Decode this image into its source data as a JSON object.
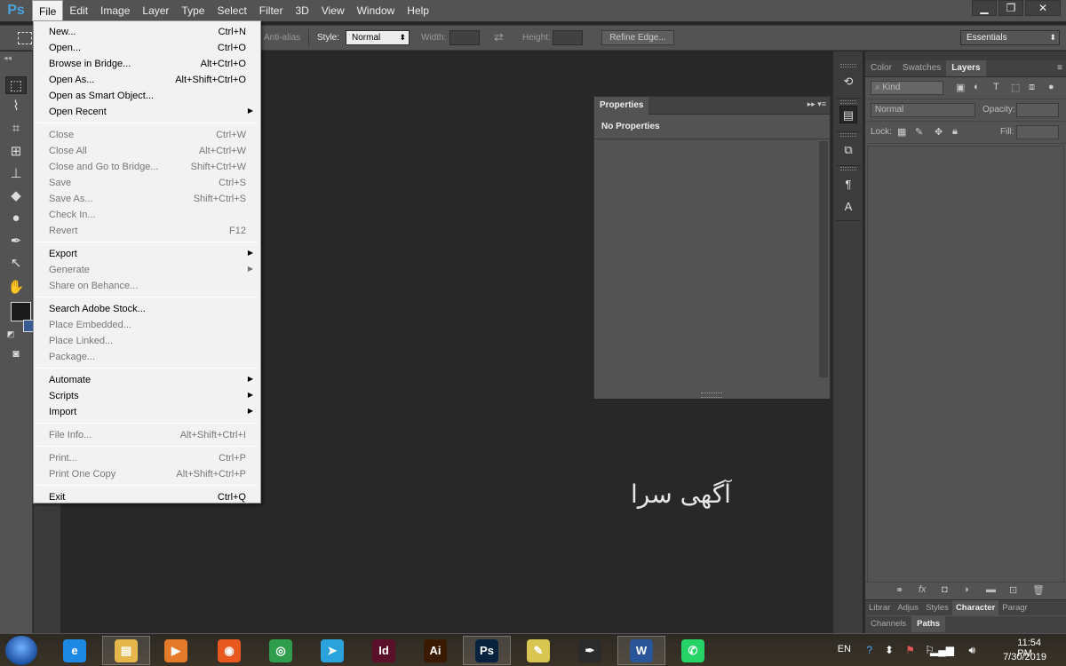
{
  "app": {
    "logo": "Ps"
  },
  "menubar": {
    "items": [
      "File",
      "Edit",
      "Image",
      "Layer",
      "Type",
      "Select",
      "Filter",
      "3D",
      "View",
      "Window",
      "Help"
    ]
  },
  "window_controls": {
    "minimize": "▁",
    "restore": "❐",
    "close": "✕"
  },
  "options_bar": {
    "anti_alias": "Anti-alias",
    "style_label": "Style:",
    "style_value": "Normal",
    "width_label": "Width:",
    "height_label": "Height:",
    "refine_edge": "Refine Edge...",
    "workspace": "Essentials"
  },
  "file_menu": {
    "items": [
      {
        "label": "New...",
        "shortcut": "Ctrl+N",
        "enabled": true
      },
      {
        "label": "Open...",
        "shortcut": "Ctrl+O",
        "enabled": true
      },
      {
        "label": "Browse in Bridge...",
        "shortcut": "Alt+Ctrl+O",
        "enabled": true
      },
      {
        "label": "Open As...",
        "shortcut": "Alt+Shift+Ctrl+O",
        "enabled": true
      },
      {
        "label": "Open as Smart Object...",
        "shortcut": "",
        "enabled": true
      },
      {
        "label": "Open Recent",
        "shortcut": "",
        "enabled": true,
        "submenu": true
      },
      {
        "label": "Close",
        "shortcut": "Ctrl+W",
        "enabled": false
      },
      {
        "label": "Close All",
        "shortcut": "Alt+Ctrl+W",
        "enabled": false
      },
      {
        "label": "Close and Go to Bridge...",
        "shortcut": "Shift+Ctrl+W",
        "enabled": false
      },
      {
        "label": "Save",
        "shortcut": "Ctrl+S",
        "enabled": false
      },
      {
        "label": "Save As...",
        "shortcut": "Shift+Ctrl+S",
        "enabled": false
      },
      {
        "label": "Check In...",
        "shortcut": "",
        "enabled": false
      },
      {
        "label": "Revert",
        "shortcut": "F12",
        "enabled": false
      },
      {
        "label": "Export",
        "shortcut": "",
        "enabled": true,
        "submenu": true
      },
      {
        "label": "Generate",
        "shortcut": "",
        "enabled": false,
        "submenu": true
      },
      {
        "label": "Share on Behance...",
        "shortcut": "",
        "enabled": false
      },
      {
        "label": "Search Adobe Stock...",
        "shortcut": "",
        "enabled": true
      },
      {
        "label": "Place Embedded...",
        "shortcut": "",
        "enabled": false
      },
      {
        "label": "Place Linked...",
        "shortcut": "",
        "enabled": false
      },
      {
        "label": "Package...",
        "shortcut": "",
        "enabled": false
      },
      {
        "label": "Automate",
        "shortcut": "",
        "enabled": true,
        "submenu": true
      },
      {
        "label": "Scripts",
        "shortcut": "",
        "enabled": true,
        "submenu": true
      },
      {
        "label": "Import",
        "shortcut": "",
        "enabled": true,
        "submenu": true
      },
      {
        "label": "File Info...",
        "shortcut": "Alt+Shift+Ctrl+I",
        "enabled": false
      },
      {
        "label": "Print...",
        "shortcut": "Ctrl+P",
        "enabled": false
      },
      {
        "label": "Print One Copy",
        "shortcut": "Alt+Shift+Ctrl+P",
        "enabled": false
      },
      {
        "label": "Exit",
        "shortcut": "Ctrl+Q",
        "enabled": true
      }
    ]
  },
  "properties_panel": {
    "tab": "Properties",
    "message": "No Properties",
    "controls": "▸▸  ▾≡"
  },
  "layers_panel": {
    "tabs": [
      "Color",
      "Swatches",
      "Layers"
    ],
    "filter_kind": "Kind",
    "blend_mode": "Normal",
    "opacity_label": "Opacity:",
    "lock_label": "Lock:",
    "fill_label": "Fill:",
    "bottom_tabs_1": [
      "Librar",
      "Adjus",
      "Styles",
      "Character",
      "Paragr"
    ],
    "bottom_tabs_2": [
      "Channels",
      "Paths"
    ]
  },
  "canvas": {
    "watermark": "آگهی سرا"
  },
  "taskbar": {
    "apps": [
      {
        "name": "internet-explorer",
        "glyph": "e",
        "color": "#1e88e5"
      },
      {
        "name": "file-explorer",
        "glyph": "▤",
        "color": "#e5b64a"
      },
      {
        "name": "media-player",
        "glyph": "▶",
        "color": "#e57a2a"
      },
      {
        "name": "firefox",
        "glyph": "◉",
        "color": "#e8581f"
      },
      {
        "name": "chrome",
        "glyph": "◎",
        "color": "#2e9d4c"
      },
      {
        "name": "telegram",
        "glyph": "➤",
        "color": "#2aa3dd"
      },
      {
        "name": "indesign",
        "glyph": "Id",
        "color": "#5a0f2a"
      },
      {
        "name": "illustrator",
        "glyph": "Ai",
        "color": "#3a1a00"
      },
      {
        "name": "photoshop",
        "glyph": "Ps",
        "color": "#07223d"
      },
      {
        "name": "sticky-notes",
        "glyph": "✎",
        "color": "#d8c650"
      },
      {
        "name": "corel",
        "glyph": "✒",
        "color": "#2b2b2b"
      },
      {
        "name": "word",
        "glyph": "W",
        "color": "#2a5699"
      },
      {
        "name": "whatsapp",
        "glyph": "✆",
        "color": "#25d366"
      }
    ],
    "lang": "EN",
    "time": "11:54 PM",
    "date": "7/30/2019"
  }
}
